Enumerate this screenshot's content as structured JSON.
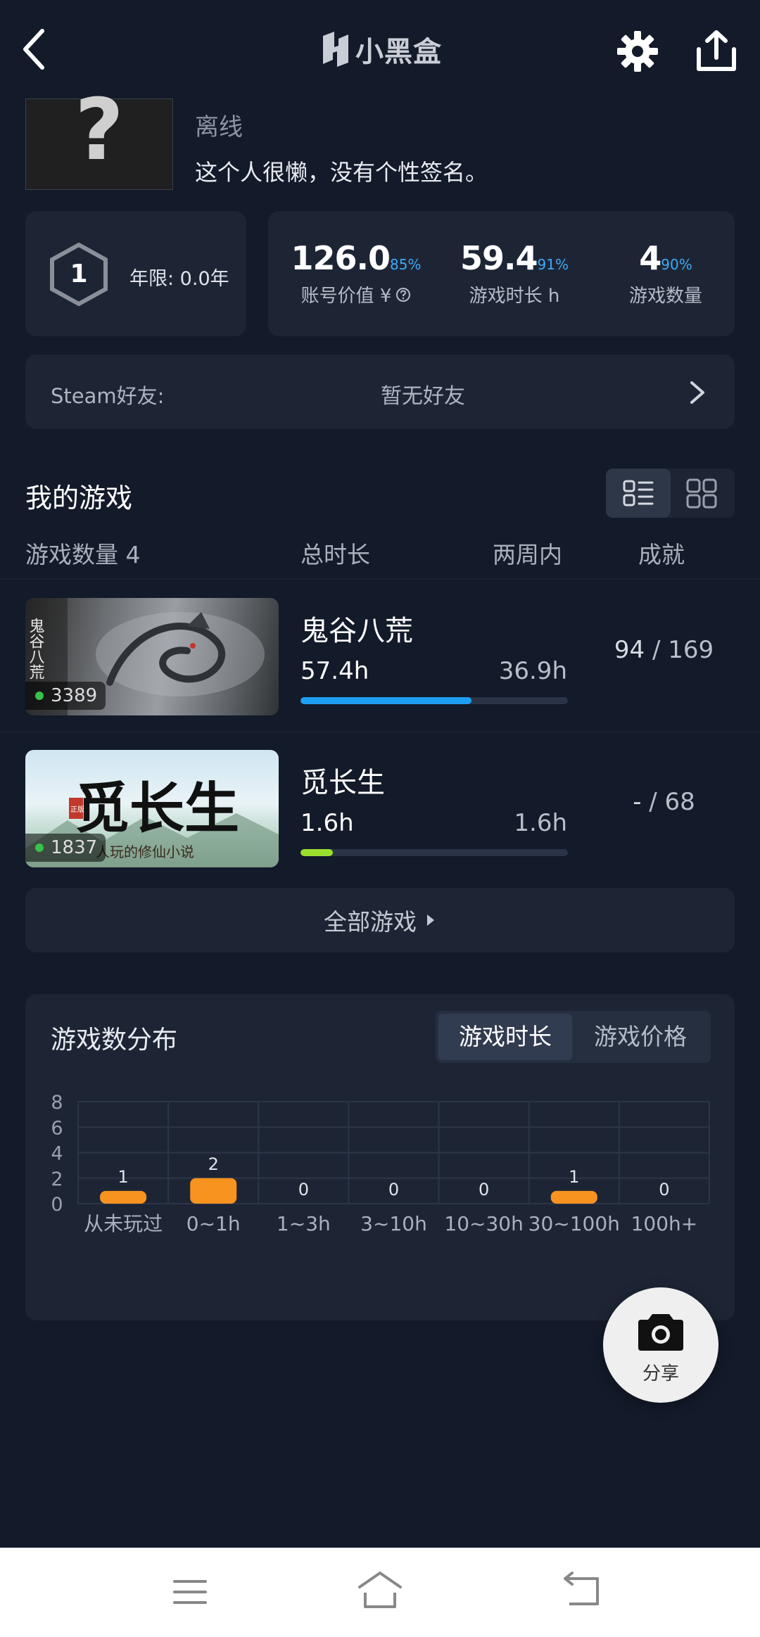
{
  "header": {
    "logo_text": "小黑盒"
  },
  "profile": {
    "avatar_glyph": "?",
    "status": "离线",
    "signature": "这个人很懒，没有个性签名。"
  },
  "level": {
    "value": "1",
    "years_label": "年限: 0.0年"
  },
  "stats": [
    {
      "value": "126.0",
      "pct": "85%",
      "label": "账号价值 ¥"
    },
    {
      "value": "59.4",
      "pct": "91%",
      "label": "游戏时长 h"
    },
    {
      "value": "4",
      "pct": "90%",
      "label": "游戏数量"
    }
  ],
  "friends": {
    "label": "Steam好友:",
    "value": "暂无好友"
  },
  "my_games": {
    "title": "我的游戏",
    "columns": {
      "count": "游戏数量 4",
      "total": "总时长",
      "recent": "两周内",
      "achievements": "成就"
    },
    "games": [
      {
        "name": "鬼谷八荒",
        "players": "3389",
        "total": "57.4h",
        "recent": "36.9h",
        "progress": 0.64,
        "ach_done": "94",
        "ach_sep": " / ",
        "ach_total": "169",
        "cover_text": "鬼谷八荒"
      },
      {
        "name": "觅长生",
        "players": "1837",
        "total": "1.6h",
        "recent": "1.6h",
        "progress": 0.12,
        "ach_done": "-",
        "ach_sep": " / ",
        "ach_total": "68",
        "cover_text": "觅长生",
        "cover_seal": "正版",
        "cover_sub": "人玩的修仙小说"
      }
    ],
    "all_games_label": "全部游戏"
  },
  "distribution": {
    "title": "游戏数分布",
    "tabs": [
      "游戏时长",
      "游戏价格"
    ],
    "share_label": "分享"
  },
  "colors": {
    "background": "#131a29",
    "card": "#1d2535",
    "accent_blue": "#1e9ff2",
    "accent_green": "#9ade2e",
    "bar_orange": "#f7931e"
  },
  "chart_data": {
    "type": "bar",
    "categories": [
      "从未玩过",
      "0~1h",
      "1~3h",
      "3~10h",
      "10~30h",
      "30~100h",
      "100h+"
    ],
    "values": [
      1,
      2,
      0,
      0,
      0,
      1,
      0
    ],
    "yticks": [
      "0",
      "2",
      "4",
      "6",
      "8"
    ],
    "ylim": [
      0,
      8
    ],
    "grid": true
  }
}
